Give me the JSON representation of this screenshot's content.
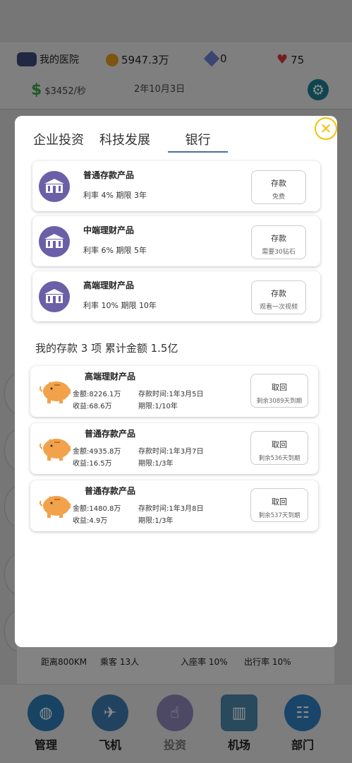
{
  "header": {
    "hospital_name": "我的医院",
    "coins": "5947.3万",
    "diamonds": "0",
    "hearts": "75",
    "income": "$3452/秒",
    "date": "2年10月3日"
  },
  "background_strip": {
    "distance": "距离800KM",
    "passengers": "乘客 13人",
    "load_rate": "入座率 10%",
    "outbound_rate": "出行率 10%"
  },
  "bottom_nav": [
    {
      "label": "管理",
      "icon": "globe-icon"
    },
    {
      "label": "飞机",
      "icon": "airplane-icon"
    },
    {
      "label": "投资",
      "icon": "hand-coin-icon"
    },
    {
      "label": "机场",
      "icon": "airport-tower-icon"
    },
    {
      "label": "部门",
      "icon": "org-chart-icon"
    }
  ],
  "tabs": [
    {
      "label": "企业投资"
    },
    {
      "label": "科技发展"
    },
    {
      "label": "银行"
    }
  ],
  "products": [
    {
      "name": "普通存款产品",
      "meta": "利率 4% 期限 3年",
      "button": "存款",
      "cost": "免费"
    },
    {
      "name": "中端理财产品",
      "meta": "利率 6% 期限 5年",
      "button": "存款",
      "cost": "需要30钻石"
    },
    {
      "name": "高端理财产品",
      "meta": "利率 10% 期限 10年",
      "button": "存款",
      "cost": "观看一次视频"
    }
  ],
  "summary": "我的存款 3 项  累计金额 1.5亿",
  "deposits": [
    {
      "name": "高端理财产品",
      "amount": "金额:8226.1万",
      "time": "存款时间:1年3月5日",
      "earnings": "收益:68.6万",
      "term": "期限:1/10年",
      "button": "取回",
      "remain": "剩余3089天到期"
    },
    {
      "name": "普通存款产品",
      "amount": "金额:4935.8万",
      "time": "存款时间:1年3月7日",
      "earnings": "收益:16.5万",
      "term": "期限:1/3年",
      "button": "取回",
      "remain": "剩余536天到期"
    },
    {
      "name": "普通存款产品",
      "amount": "金额:1480.8万",
      "time": "存款时间:1年3月8日",
      "earnings": "收益:4.9万",
      "term": "期限:1/3年",
      "button": "取回",
      "remain": "剩余537天到期"
    }
  ],
  "colors": {
    "accent_tab_underline": "#4a6fa0",
    "close_ring": "#f2c300",
    "product_icon_bg": "#6b5fa8",
    "pig": "#f2a24a"
  }
}
